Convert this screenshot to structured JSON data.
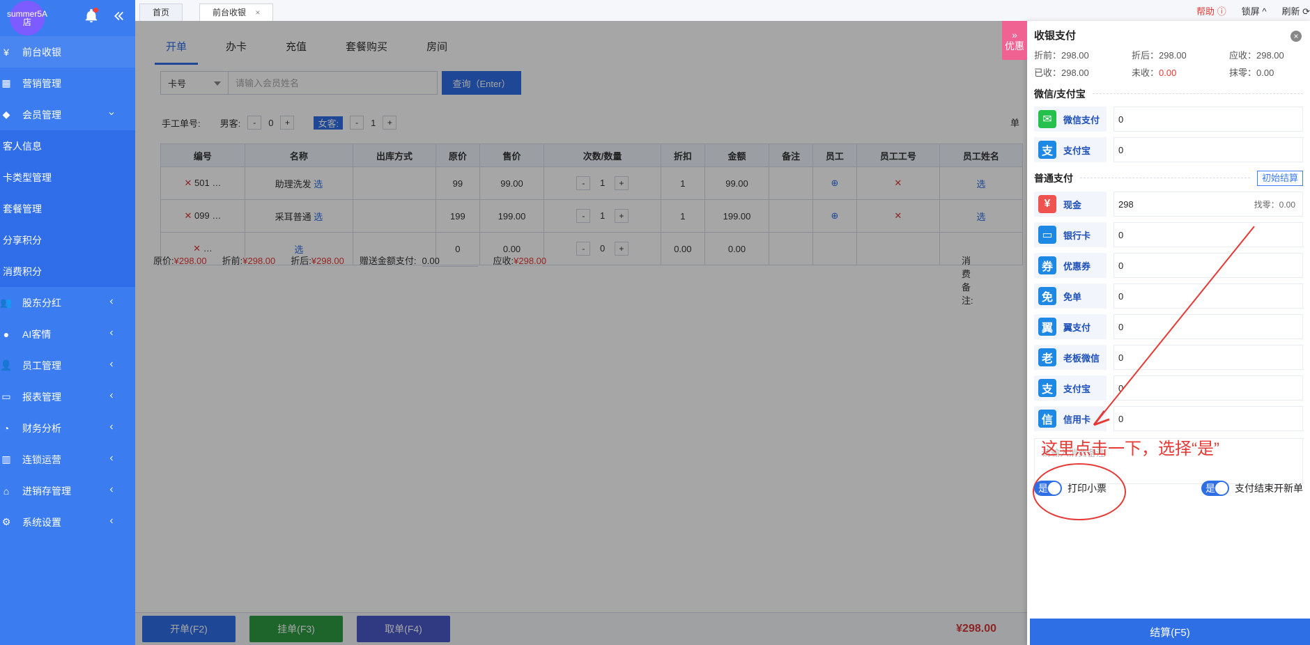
{
  "sidebar": {
    "avatar_text": "summer5A店",
    "items": [
      {
        "label": "前台收银",
        "icon": "yen-icon"
      },
      {
        "label": "营销管理",
        "icon": "grid-icon"
      },
      {
        "label": "会员管理",
        "icon": "tag-icon"
      },
      {
        "label": "客人信息"
      },
      {
        "label": "卡类型管理"
      },
      {
        "label": "套餐管理"
      },
      {
        "label": "分享积分"
      },
      {
        "label": "消费积分"
      },
      {
        "label": "股东分红",
        "icon": "people-icon"
      },
      {
        "label": "AI客情",
        "icon": "ai-icon"
      },
      {
        "label": "员工管理",
        "icon": "user-icon"
      },
      {
        "label": "报表管理",
        "icon": "monitor-icon"
      },
      {
        "label": "财务分析",
        "icon": "pie-icon"
      },
      {
        "label": "连锁运营",
        "icon": "building-icon"
      },
      {
        "label": "进销存管理",
        "icon": "store-icon"
      },
      {
        "label": "系统设置",
        "icon": "gear-icon"
      }
    ]
  },
  "topbar": {
    "tabs": [
      {
        "label": "首页"
      },
      {
        "label": "前台收银",
        "close": "×"
      }
    ],
    "right": {
      "help": "帮助",
      "lock": "锁屏",
      "refresh": "刷新"
    }
  },
  "main": {
    "subtabs": [
      "开单",
      "办卡",
      "充值",
      "套餐购买",
      "房间"
    ],
    "search": {
      "type": "卡号",
      "placeholder": "请输入会员姓名",
      "button": "查询（Enter）"
    },
    "meta": {
      "manual_order_label": "手工单号:",
      "male_label": "男客:",
      "male_count": "0",
      "female_label": "女客:",
      "female_count": "1",
      "minus": "-",
      "plus": "+",
      "right_cut": "单"
    },
    "table": {
      "headers": [
        "编号",
        "名称",
        "出库方式",
        "原价",
        "售价",
        "次数/数量",
        "折扣",
        "金额",
        "备注",
        "员工",
        "员工工号",
        "员工姓名"
      ],
      "rows": [
        {
          "code": "501",
          "name": "助理洗发",
          "select": "选",
          "orig": "99",
          "price": "99.00",
          "qty": "1",
          "discount": "1",
          "amount": "99.00"
        },
        {
          "code": "099",
          "name": "采耳普通",
          "select": "选",
          "orig": "199",
          "price": "199.00",
          "qty": "1",
          "discount": "1",
          "amount": "199.00"
        },
        {
          "code": "",
          "name": "",
          "select": "选",
          "orig": "0",
          "price": "0.00",
          "qty": "0",
          "discount": "0.00",
          "amount": "0.00"
        }
      ],
      "staff_select": "选"
    },
    "totals": {
      "orig_label": "原价:",
      "orig": "¥298.00",
      "before_label": "折前:",
      "before": "¥298.00",
      "after_label": "折后:",
      "after": "¥298.00",
      "gift_label": "赠送金额支付:",
      "gift": "0.00",
      "due_label": "应收:",
      "due": "¥298.00",
      "remark_label": "消费备注:"
    },
    "bottom": {
      "open": "开单(F2)",
      "hang": "挂单(F3)",
      "take": "取单(F4)",
      "sum": "¥298.00"
    }
  },
  "panel": {
    "promo": "优惠",
    "title": "收银支付",
    "summary": {
      "before": "折前：298.00",
      "after": "折后：298.00",
      "due": "应收：298.00",
      "received": "已收：298.00",
      "unpaid_label": "未收：",
      "unpaid": "0.00",
      "round": "抹零：0.00"
    },
    "wechat_section": "微信/支付宝",
    "wechat": [
      {
        "label": "微信支付",
        "value": "0",
        "icon": "wechat-icon"
      },
      {
        "label": "支付宝",
        "value": "0",
        "icon": "alipay-icon"
      }
    ],
    "normal_section": "普通支付",
    "init_settle": "初始结算",
    "normal": [
      {
        "label": "现金",
        "value": "298",
        "icon": "cash-icon",
        "change": "找零：0.00"
      },
      {
        "label": "银行卡",
        "value": "0",
        "icon": "card-icon"
      },
      {
        "label": "优惠券",
        "value": "0",
        "icon": "coupon-icon"
      },
      {
        "label": "免单",
        "value": "0",
        "icon": "free-icon"
      },
      {
        "label": "翼支付",
        "value": "0",
        "icon": "wing-icon"
      },
      {
        "label": "老板微信",
        "value": "0",
        "icon": "boss-icon"
      },
      {
        "label": "支付宝",
        "value": "0",
        "icon": "alipay2-icon"
      },
      {
        "label": "信用卡",
        "value": "0",
        "icon": "credit-icon"
      }
    ],
    "note_placeholder": "请输入消费备注",
    "annotation": "这里点击一下，选择“是”",
    "toggles": {
      "print_label": "打印小票",
      "print_state": "是",
      "new_order_label": "支付结束开新单",
      "new_order_state": "是"
    },
    "settle_button": "结算(F5)"
  }
}
